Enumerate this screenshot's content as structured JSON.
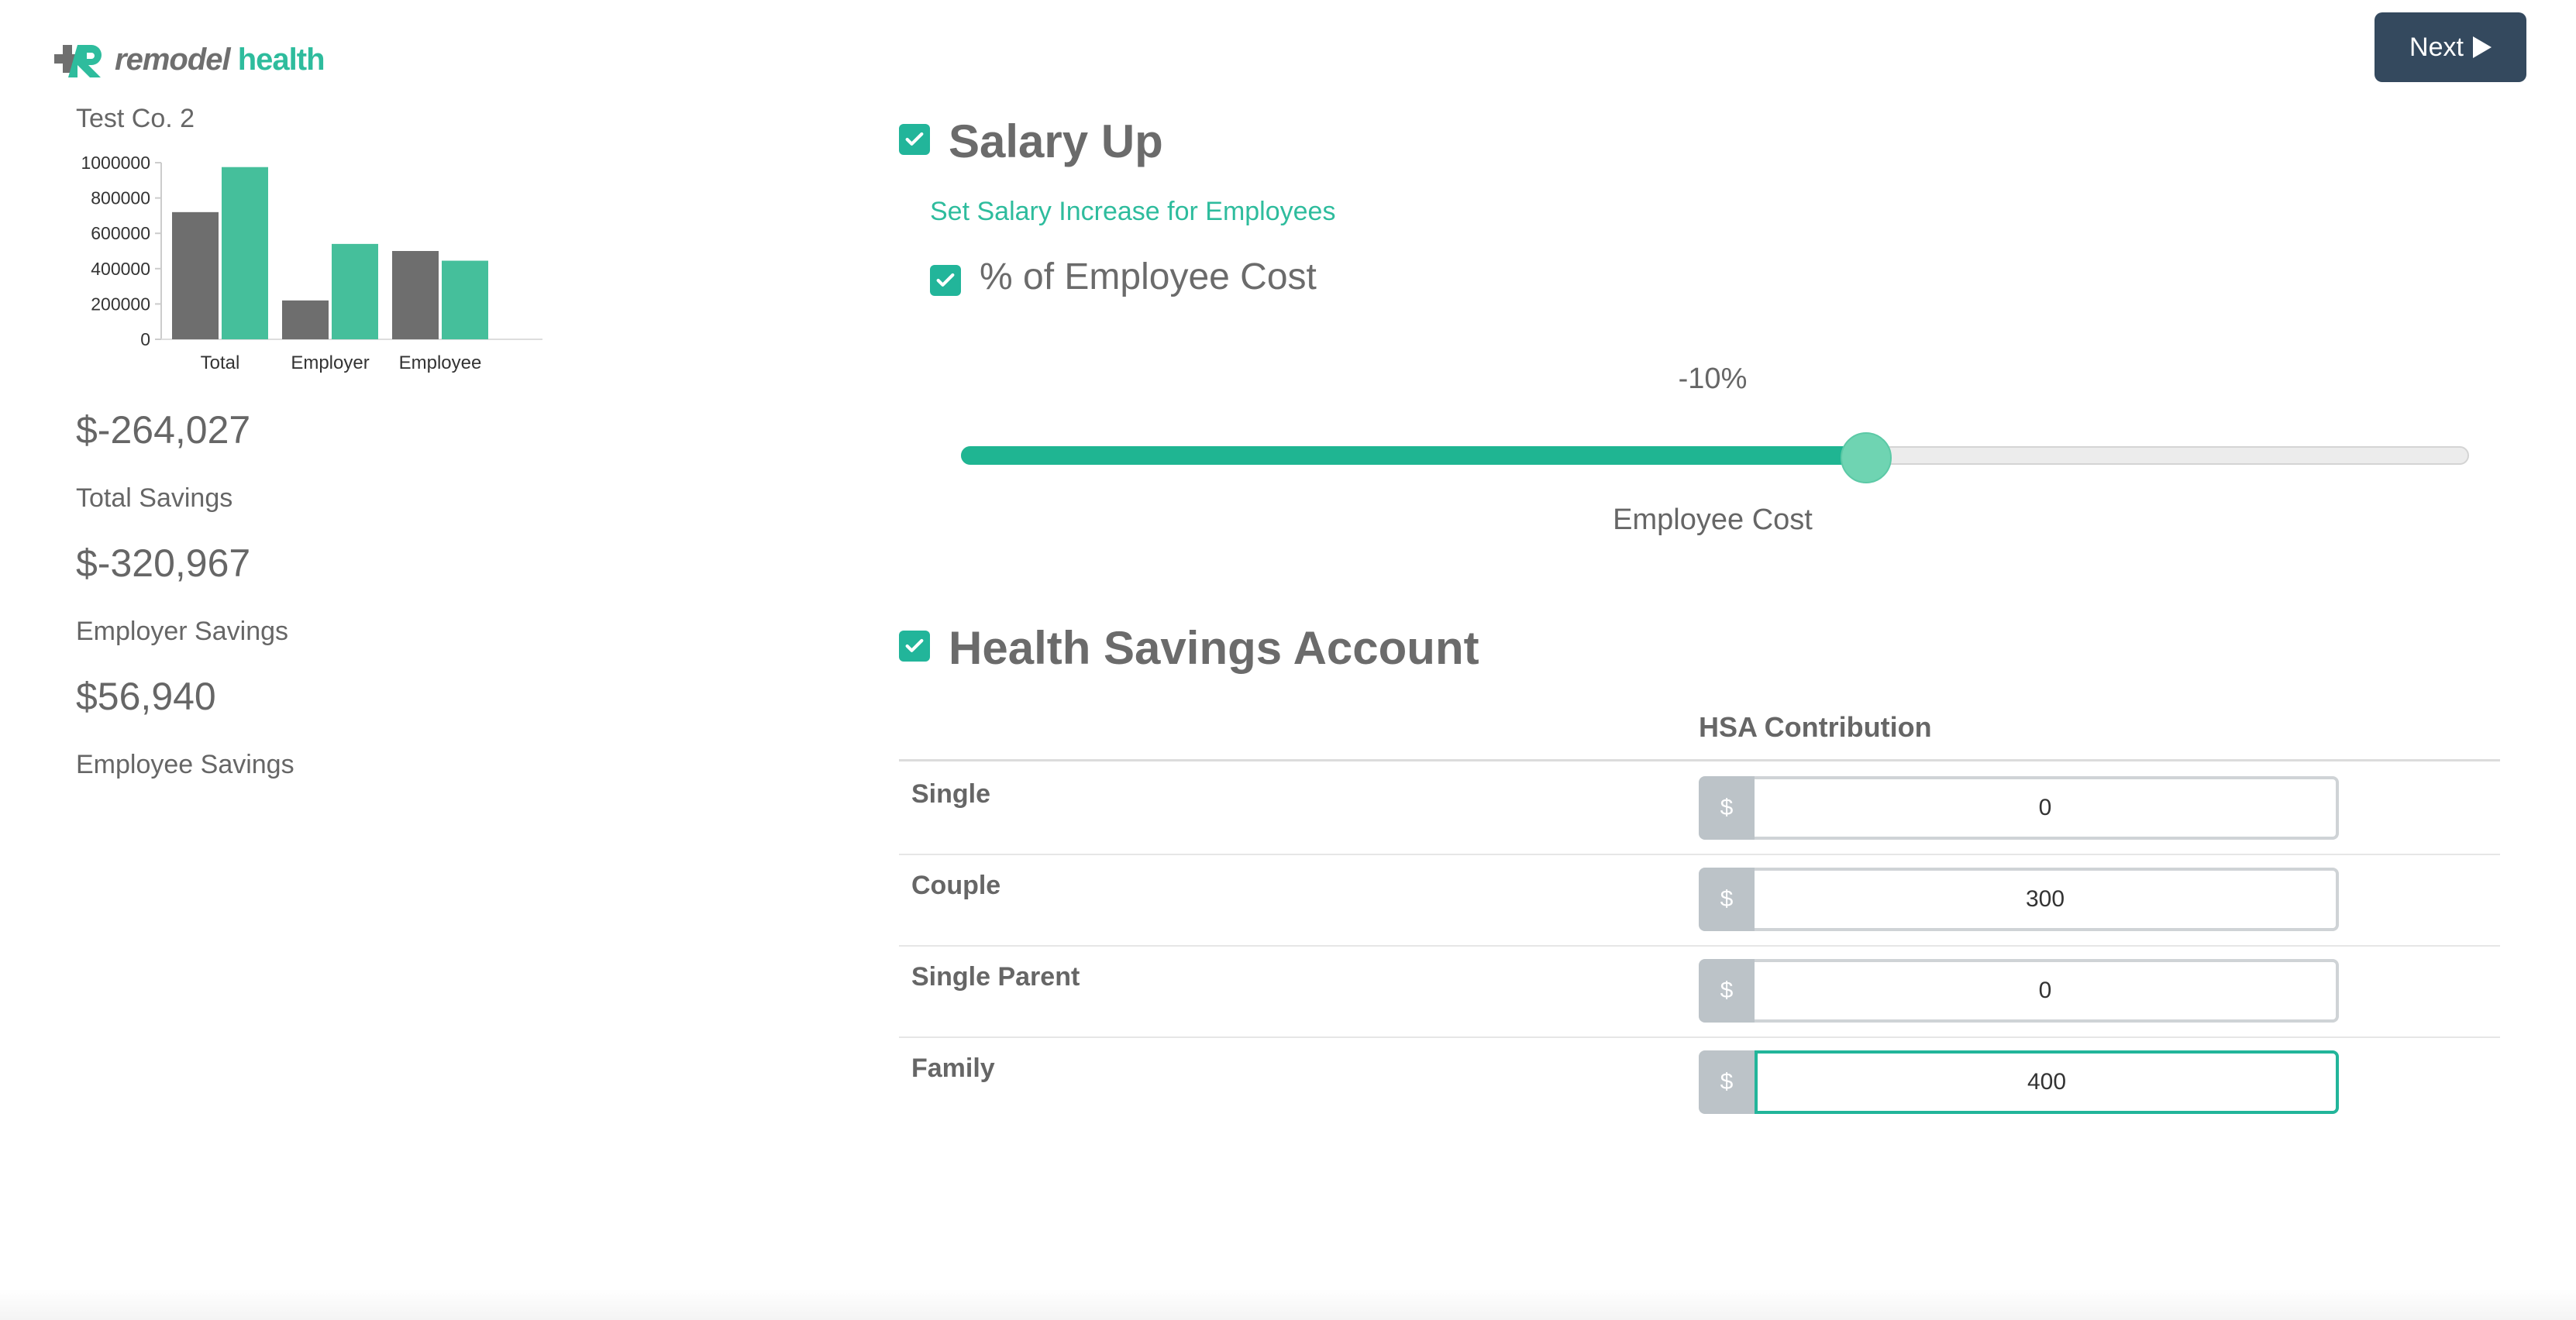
{
  "logo": {
    "word1": "remodel",
    "word2": "health"
  },
  "header": {
    "next_label": "Next"
  },
  "company": {
    "name": "Test Co. 2"
  },
  "chart_data": {
    "type": "bar",
    "categories": [
      "Total",
      "Employer",
      "Employee"
    ],
    "series": [
      {
        "values": [
          720000,
          220000,
          500000
        ],
        "color": "#6e6e6e"
      },
      {
        "values": [
          975000,
          540000,
          445000
        ],
        "color": "#45bf9b"
      }
    ],
    "yticks": [
      "1000000",
      "800000",
      "600000",
      "400000",
      "200000",
      "0"
    ],
    "ylim": [
      0,
      1000000
    ],
    "grid": false
  },
  "metrics": [
    {
      "value": "$-264,027",
      "label": "Total Savings"
    },
    {
      "value": "$-320,967",
      "label": "Employer Savings"
    },
    {
      "value": "$56,940",
      "label": "Employee Savings"
    }
  ],
  "salary": {
    "title": "Salary Up",
    "link": "Set Salary Increase for Employees",
    "option_label": "% of Employee Cost",
    "slider_value": "-10%",
    "slider_fraction": 0.6,
    "slider_label": "Employee Cost"
  },
  "hsa": {
    "title": "Health Savings Account",
    "column_header": "HSA Contribution",
    "currency_symbol": "$",
    "rows": [
      {
        "label": "Single",
        "value": "0"
      },
      {
        "label": "Couple",
        "value": "300"
      },
      {
        "label": "Single Parent",
        "value": "0"
      },
      {
        "label": "Family",
        "value": "400"
      }
    ]
  },
  "colors": {
    "accent": "#2ebc9d",
    "button": "#34495e",
    "bar_gray": "#6e6e6e",
    "bar_green": "#45bf9b"
  }
}
